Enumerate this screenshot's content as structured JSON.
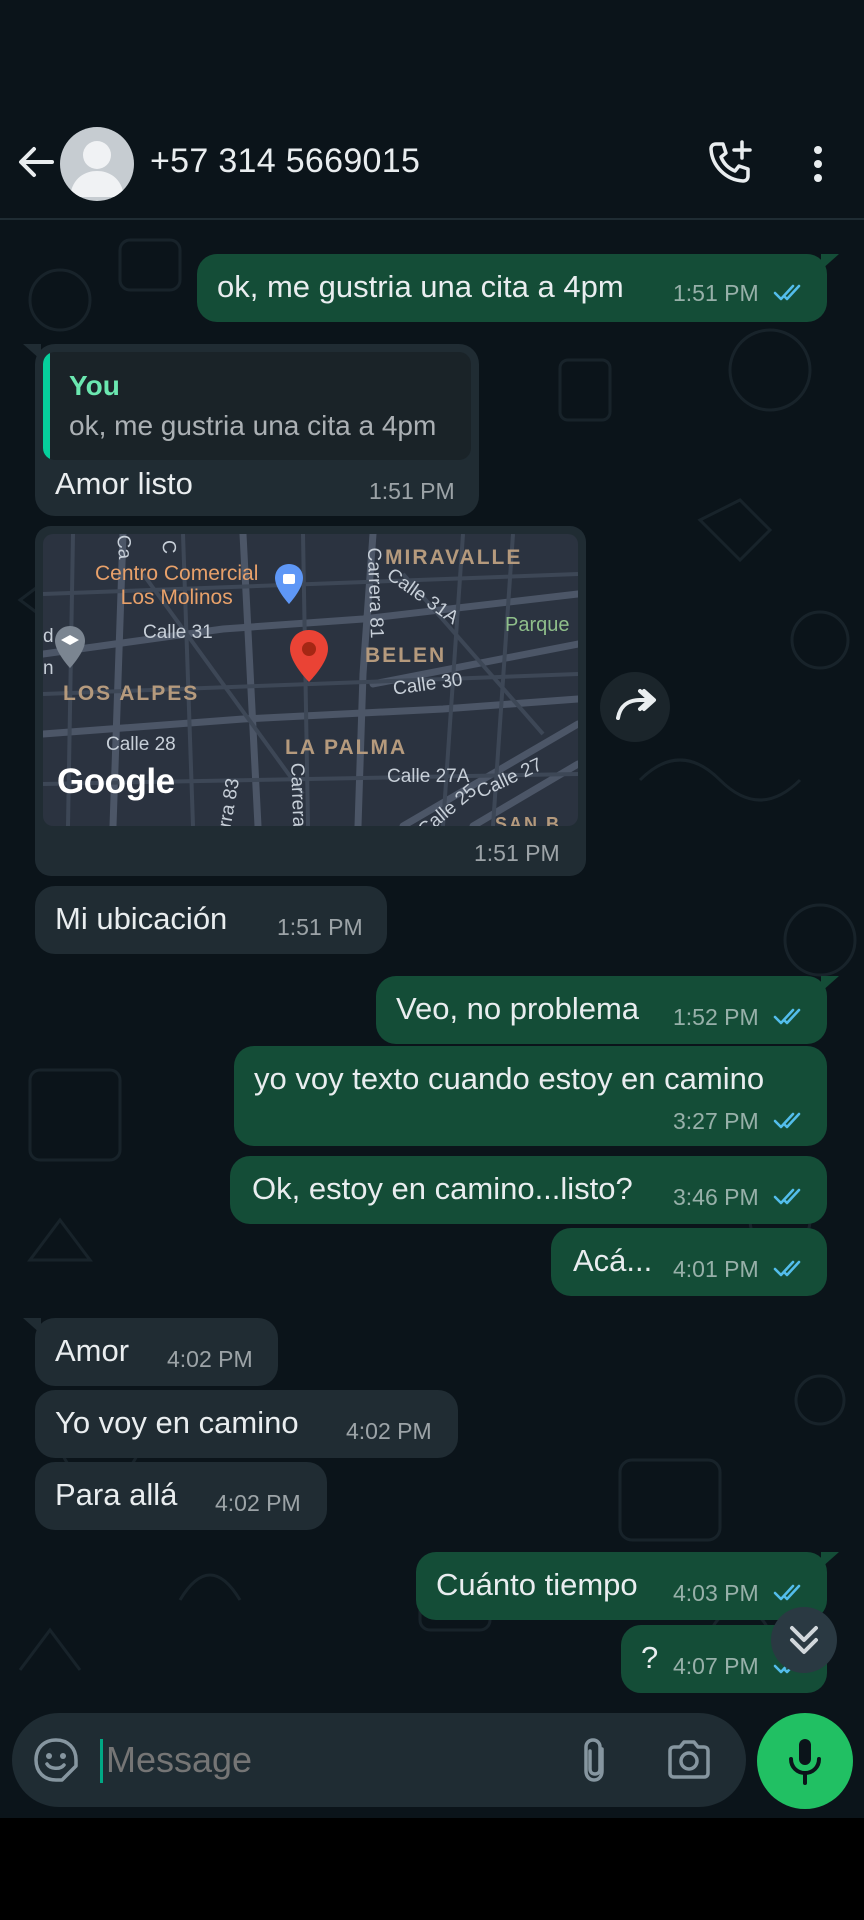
{
  "header": {
    "title": "+57 314 5669015"
  },
  "messages": [
    {
      "id": "m1",
      "dir": "out",
      "text": "ok, me gustria una cita a 4pm",
      "time": "1:51 PM"
    },
    {
      "id": "m2",
      "dir": "in",
      "quote_author": "You",
      "quote_text": "ok, me gustria una cita a 4pm",
      "text": "Amor listo",
      "time": "1:51 PM"
    },
    {
      "id": "m3",
      "dir": "in",
      "type": "location",
      "time": "1:51 PM"
    },
    {
      "id": "m4",
      "dir": "in",
      "text": "Mi ubicación",
      "time": "1:51 PM"
    },
    {
      "id": "m5",
      "dir": "out",
      "text": "Veo, no problema",
      "time": "1:52 PM"
    },
    {
      "id": "m6",
      "dir": "out",
      "text": "yo voy texto cuando estoy en camino",
      "time": "3:27 PM"
    },
    {
      "id": "m7",
      "dir": "out",
      "text": "Ok, estoy en camino...listo?",
      "time": "3:46 PM"
    },
    {
      "id": "m8",
      "dir": "out",
      "text": "Acá...",
      "time": "4:01 PM"
    },
    {
      "id": "m9",
      "dir": "in",
      "text": "Amor",
      "time": "4:02 PM"
    },
    {
      "id": "m10",
      "dir": "in",
      "text": "Yo voy en camino",
      "time": "4:02 PM"
    },
    {
      "id": "m11",
      "dir": "in",
      "text": "Para allá",
      "time": "4:02 PM"
    },
    {
      "id": "m12",
      "dir": "out",
      "text": "Cuánto tiempo",
      "time": "4:03 PM"
    },
    {
      "id": "m13",
      "dir": "out",
      "text": "?",
      "time": "4:07 PM"
    }
  ],
  "map": {
    "poi_1_line1": "Centro Comercial",
    "poi_1_line2": "Los Molinos",
    "areas": [
      "MIRAVALLE",
      "BELEN",
      "LOS ALPES",
      "LA PALMA",
      "SAN B"
    ],
    "streets": [
      "Calle 31",
      "Calle 31A",
      "Carrera 81",
      "Calle 30",
      "Calle 28",
      "Calle 27A",
      "Calle 27",
      "Calle 25",
      "Carrera",
      "rra 83",
      "Ca",
      "C",
      "d",
      "n"
    ],
    "park": "Parque",
    "brand": "Google"
  },
  "composer": {
    "placeholder": "Message"
  },
  "colors": {
    "background": "#0b141a",
    "outgoing_bubble": "#144d37",
    "incoming_bubble": "#202c33",
    "accent_green": "#21c063",
    "read_ticks": "#53bdeb"
  },
  "icons": {
    "back": "arrow-left-icon",
    "avatar": "default-avatar-icon",
    "call": "add-call-icon",
    "menu": "more-vertical-icon",
    "forward": "forward-icon",
    "scroll": "double-chevron-down-icon",
    "emoji": "sticker-emoji-icon",
    "attach": "paperclip-icon",
    "camera": "camera-icon",
    "mic": "microphone-icon",
    "ticks": "double-check-icon",
    "pin": "location-pin-icon"
  }
}
